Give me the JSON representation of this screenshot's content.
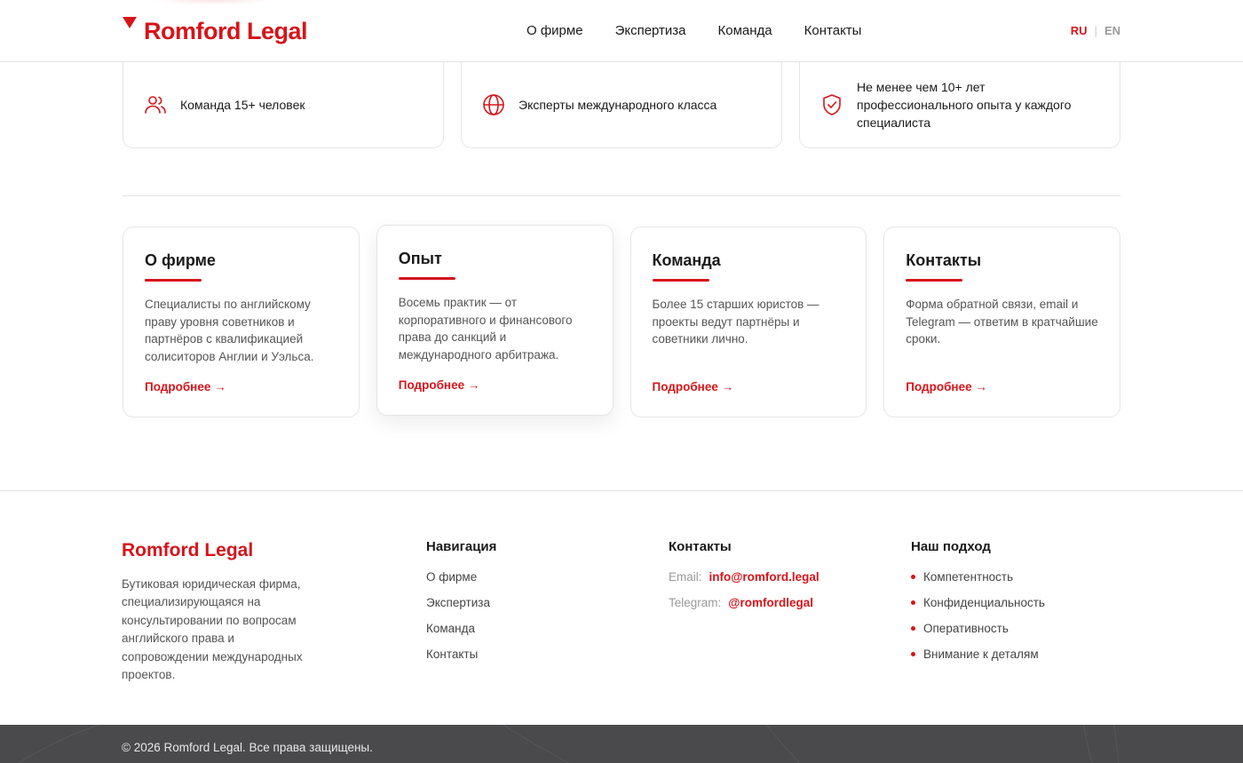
{
  "header": {
    "brand": "Romford Legal",
    "nav": [
      "О фирме",
      "Экспертиза",
      "Команда",
      "Контакты"
    ],
    "lang_ru": "RU",
    "lang_sep": "|",
    "lang_en": "EN"
  },
  "features": [
    {
      "icon": "team-icon",
      "text": "Команда 15+ человек"
    },
    {
      "icon": "globe-icon",
      "text": "Эксперты международного класса"
    },
    {
      "icon": "shield-check-icon",
      "text": "Не менее чем 10+ лет профессионального опыта у каждого специалиста"
    }
  ],
  "cards": [
    {
      "title": "О фирме",
      "text": "Специалисты по английскому праву уровня советников и партнёров с квалификацией солиситоров Англии и Уэльса.",
      "link": "Подробнее →"
    },
    {
      "title": "Опыт",
      "text": "Восемь практик — от корпоративного и финансового права до санкций и международного арбитража.",
      "link": "Подробнее →"
    },
    {
      "title": "Команда",
      "text": "Более 15 старших юристов — проекты ведут партнёры и советники лично.",
      "link": "Подробнее →"
    },
    {
      "title": "Контакты",
      "text": "Форма обратной связи, email и Telegram — ответим в кратчайшие сроки.",
      "link": "Подробнее →"
    }
  ],
  "footer": {
    "brand": "Romford Legal",
    "description": "Бутиковая юридическая фирма, специализирующаяся на консультировании по вопросам английского права и сопровождении международных проектов.",
    "nav_title": "Навигация",
    "nav": [
      "О фирме",
      "Экспертиза",
      "Команда",
      "Контакты"
    ],
    "contacts_title": "Контакты",
    "email_label": "Email:",
    "email": "info@romford.legal",
    "telegram_label": "Telegram:",
    "telegram": "@romfordlegal",
    "approach_title": "Наш подход",
    "approach": [
      "Компетентность",
      "Конфиденциальность",
      "Оперативность",
      "Внимание к деталям"
    ],
    "copyright": "© 2026 Romford Legal. Все права защищены."
  },
  "colors": {
    "accent": "#d7141a",
    "footer_bar": "#4a4a4c"
  }
}
